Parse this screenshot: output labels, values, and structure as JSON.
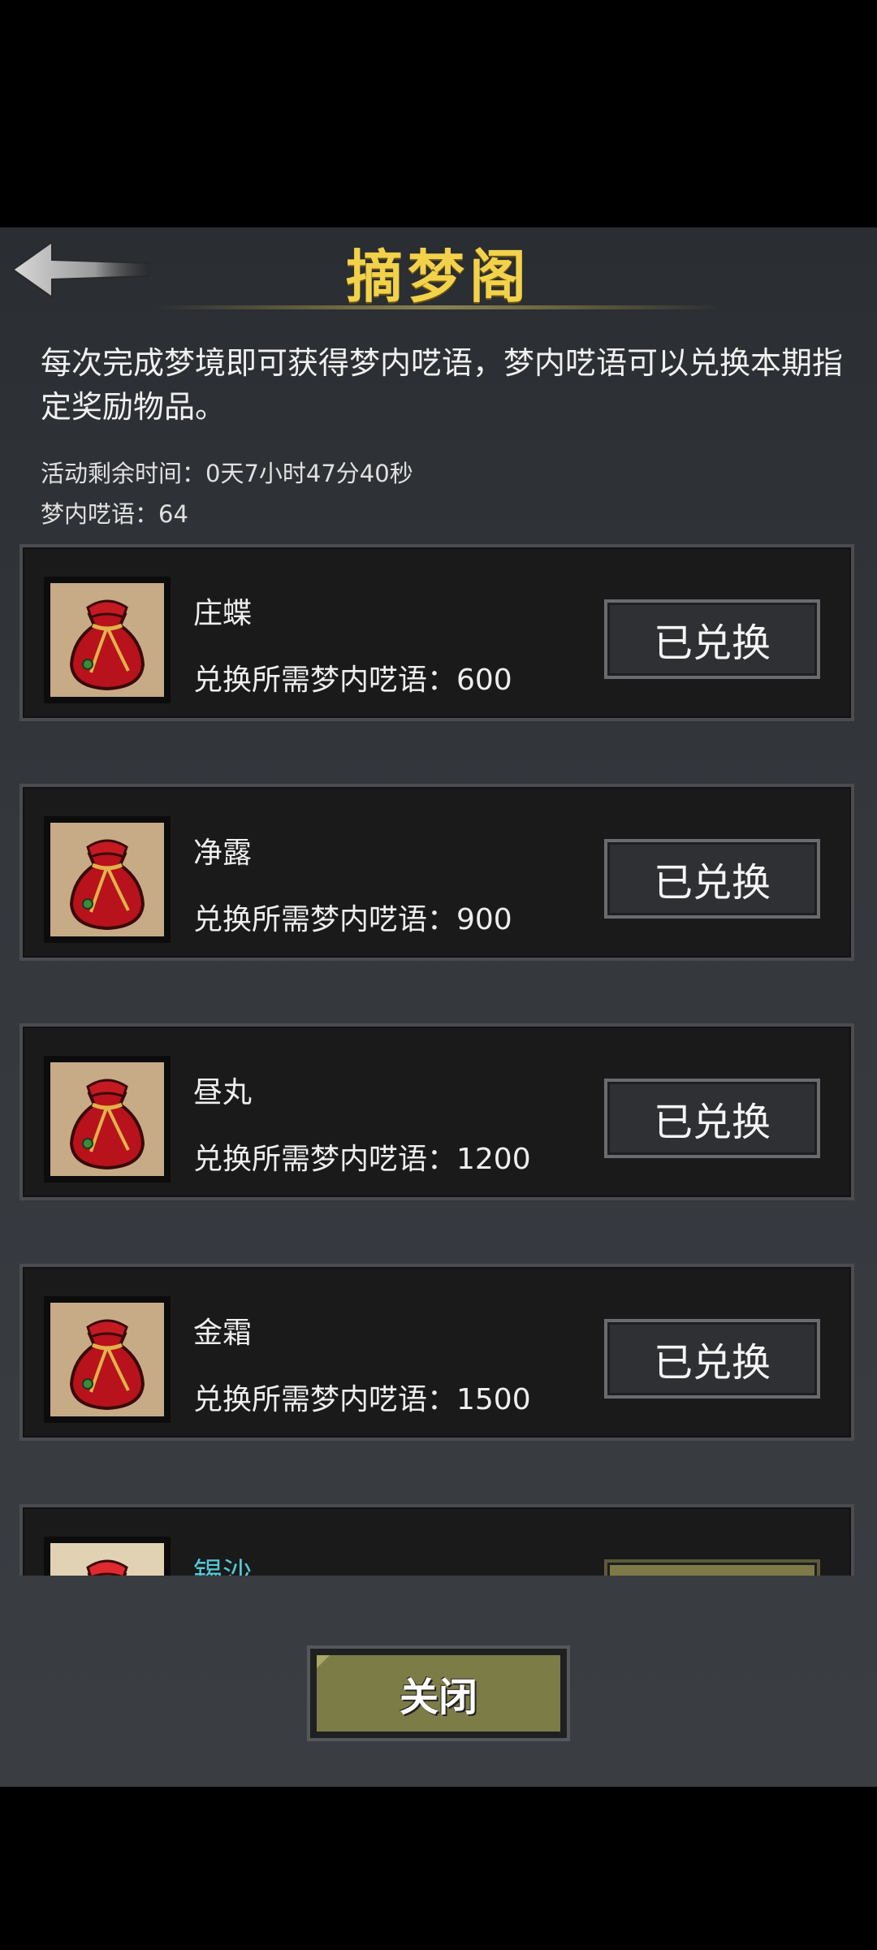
{
  "header": {
    "title": "摘梦阁"
  },
  "description": "每次完成梦境即可获得梦内呓语，梦内呓语可以兑换本期指定奖励物品。",
  "info": {
    "time_left": "活动剩余时间：0天7小时47分40秒",
    "currency": "梦内呓语：64"
  },
  "items": [
    {
      "name": "庄蝶",
      "cost": "兑换所需梦内呓语：600",
      "status": "已兑换"
    },
    {
      "name": "净露",
      "cost": "兑换所需梦内呓语：900",
      "status": "已兑换"
    },
    {
      "name": "昼丸",
      "cost": "兑换所需梦内呓语：1200",
      "status": "已兑换"
    },
    {
      "name": "金霜",
      "cost": "兑换所需梦内呓语：1500",
      "status": "已兑换"
    },
    {
      "name": "锡沙"
    }
  ],
  "footer": {
    "close_label": "关闭"
  },
  "colors": {
    "title": "#f2d24b",
    "button_active": "#7c7c47",
    "highlight_name": "#55c8d6"
  },
  "icons": {
    "back": "back-arrow-icon",
    "item": "red-pouch-icon"
  }
}
